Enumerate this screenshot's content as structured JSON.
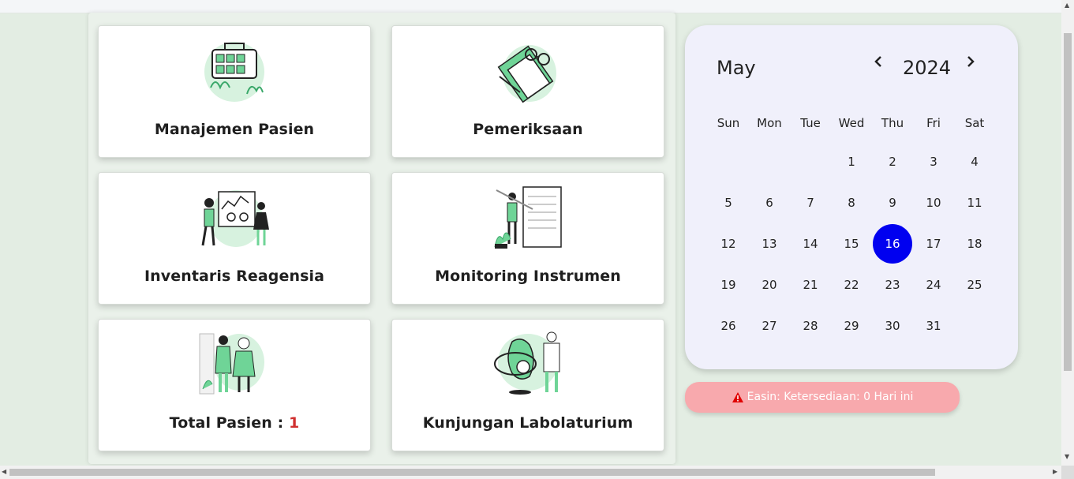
{
  "cards": [
    {
      "label": "Manajemen Pasien",
      "icon": "patient-management-illustration"
    },
    {
      "label": "Pemeriksaan",
      "icon": "examination-clipboard-illustration"
    },
    {
      "label": "Inventaris Reagensia",
      "icon": "reagent-inventory-illustration"
    },
    {
      "label": "Monitoring Instrumen",
      "icon": "instrument-monitoring-illustration"
    },
    {
      "label": "Total Pasien : ",
      "count": "1",
      "icon": "patients-illustration"
    },
    {
      "label": "Kunjungan Labolaturium",
      "icon": "lab-visit-illustration"
    }
  ],
  "calendar": {
    "month": "May",
    "year": "2024",
    "prev": "‹",
    "next": "›",
    "weekdays": [
      "Sun",
      "Mon",
      "Tue",
      "Wed",
      "Thu",
      "Fri",
      "Sat"
    ],
    "weeks": [
      [
        "",
        "",
        "",
        "1",
        "2",
        "3",
        "4"
      ],
      [
        "5",
        "6",
        "7",
        "8",
        "9",
        "10",
        "11"
      ],
      [
        "12",
        "13",
        "14",
        "15",
        "16",
        "17",
        "18"
      ],
      [
        "19",
        "20",
        "21",
        "22",
        "23",
        "24",
        "25"
      ],
      [
        "26",
        "27",
        "28",
        "29",
        "30",
        "31",
        ""
      ]
    ],
    "selected_day": "16"
  },
  "alert": {
    "icon": "warning-icon",
    "text": "Easin: Ketersediaan: 0 Hari ini"
  },
  "colors": {
    "accent": "#0000f0",
    "illustration_green": "#6fd497",
    "alert_bg": "#f8a9ad",
    "count_red": "#d0302f"
  }
}
